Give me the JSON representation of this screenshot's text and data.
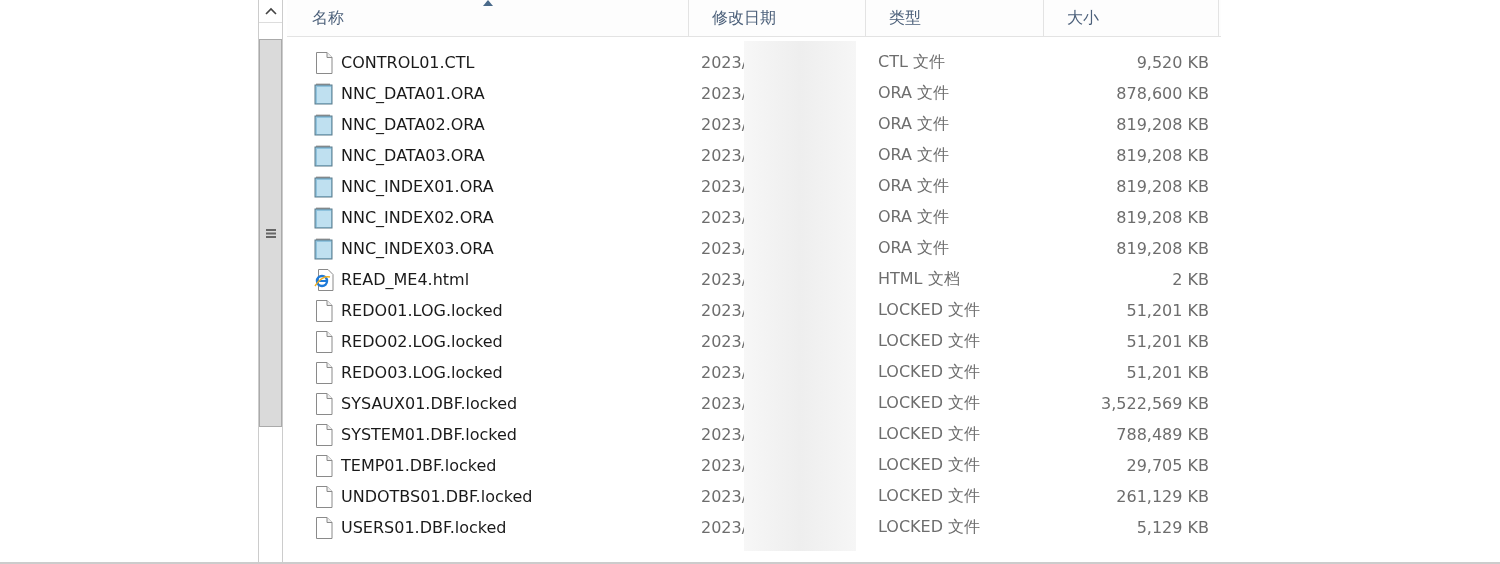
{
  "columns": [
    {
      "label": "名称",
      "sorted": true
    },
    {
      "label": "修改日期",
      "sorted": false
    },
    {
      "label": "类型",
      "sorted": false
    },
    {
      "label": "大小",
      "sorted": false
    }
  ],
  "files": [
    {
      "kind": "blank",
      "name": "CONTROL01.CTL",
      "date": "2023/",
      "type": "CTL 文件",
      "size": "9,520 KB"
    },
    {
      "kind": "notepad",
      "name": "NNC_DATA01.ORA",
      "date": "2023/",
      "type": "ORA 文件",
      "size": "878,600 KB"
    },
    {
      "kind": "notepad",
      "name": "NNC_DATA02.ORA",
      "date": "2023/",
      "type": "ORA 文件",
      "size": "819,208 KB"
    },
    {
      "kind": "notepad",
      "name": "NNC_DATA03.ORA",
      "date": "2023/",
      "type": "ORA 文件",
      "size": "819,208 KB"
    },
    {
      "kind": "notepad",
      "name": "NNC_INDEX01.ORA",
      "date": "2023/",
      "type": "ORA 文件",
      "size": "819,208 KB"
    },
    {
      "kind": "notepad",
      "name": "NNC_INDEX02.ORA",
      "date": "2023/",
      "type": "ORA 文件",
      "size": "819,208 KB"
    },
    {
      "kind": "notepad",
      "name": "NNC_INDEX03.ORA",
      "date": "2023/",
      "type": "ORA 文件",
      "size": "819,208 KB"
    },
    {
      "kind": "html",
      "name": "READ_ME4.html",
      "date": "2023/",
      "type": "HTML 文档",
      "size": "2 KB"
    },
    {
      "kind": "blank",
      "name": "REDO01.LOG.locked",
      "date": "2023/",
      "type": "LOCKED 文件",
      "size": "51,201 KB"
    },
    {
      "kind": "blank",
      "name": "REDO02.LOG.locked",
      "date": "2023/",
      "type": "LOCKED 文件",
      "size": "51,201 KB"
    },
    {
      "kind": "blank",
      "name": "REDO03.LOG.locked",
      "date": "2023/",
      "type": "LOCKED 文件",
      "size": "51,201 KB"
    },
    {
      "kind": "blank",
      "name": "SYSAUX01.DBF.locked",
      "date": "2023/",
      "type": "LOCKED 文件",
      "size": "3,522,569 KB"
    },
    {
      "kind": "blank",
      "name": "SYSTEM01.DBF.locked",
      "date": "2023/",
      "type": "LOCKED 文件",
      "size": "788,489 KB"
    },
    {
      "kind": "blank",
      "name": "TEMP01.DBF.locked",
      "date": "2023/",
      "type": "LOCKED 文件",
      "size": "29,705 KB"
    },
    {
      "kind": "blank",
      "name": "UNDOTBS01.DBF.locked",
      "date": "2023/",
      "type": "LOCKED 文件",
      "size": "261,129 KB"
    },
    {
      "kind": "blank",
      "name": "USERS01.DBF.locked",
      "date": "2023/",
      "type": "LOCKED 文件",
      "size": "5,129 KB"
    }
  ]
}
